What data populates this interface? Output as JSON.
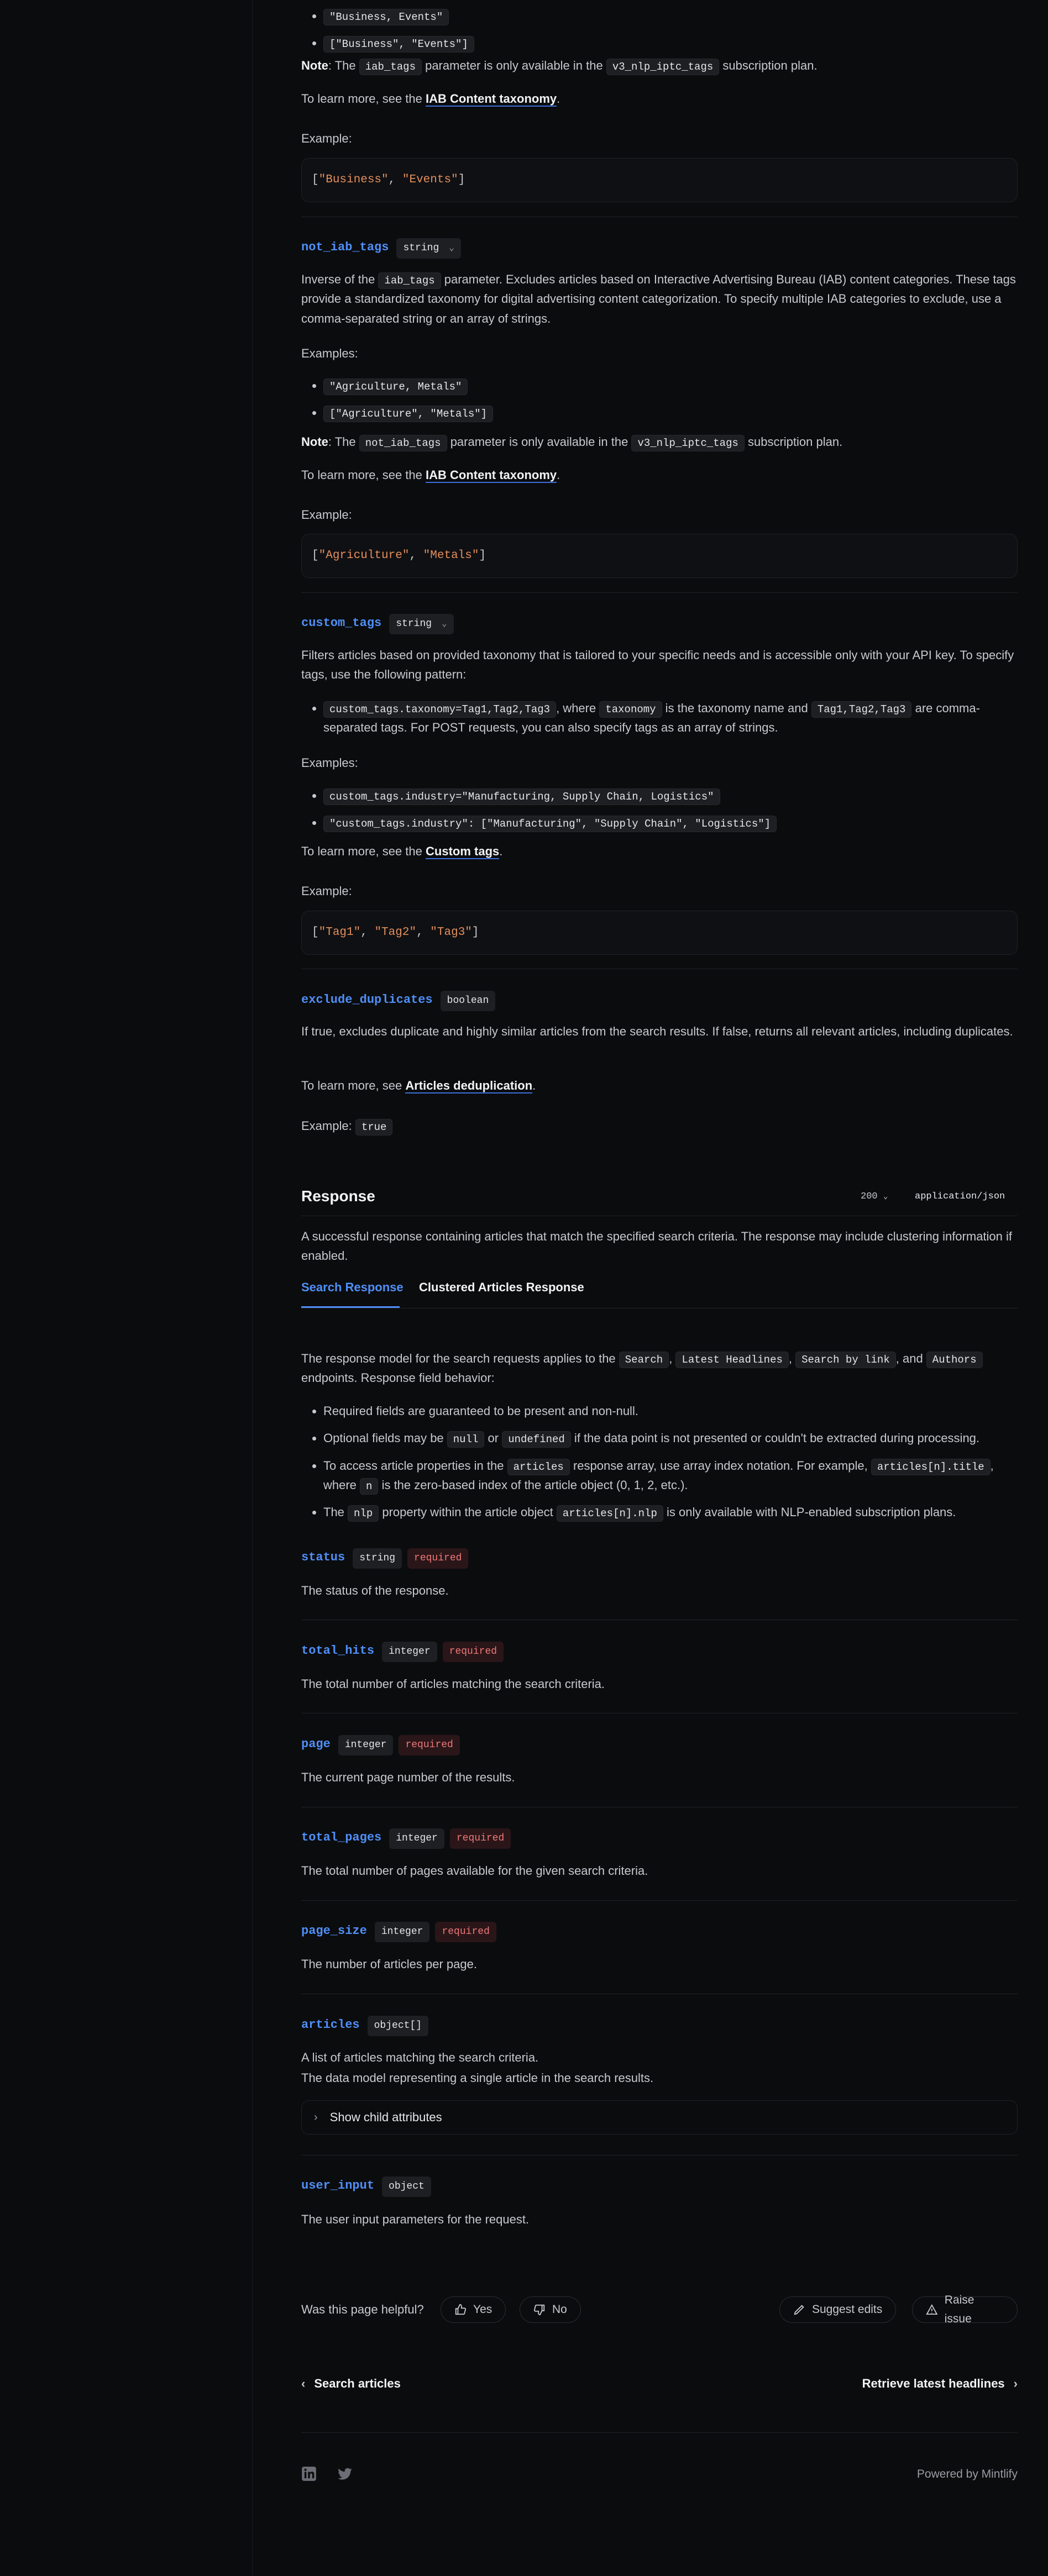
{
  "iab": {
    "ex1": "\"Business, Events\"",
    "ex2": "[\"Business\", \"Events\"]",
    "note_label": "Note",
    "note_a": ": The ",
    "note_code": "iab_tags",
    "note_b": " parameter is only available in the ",
    "note_plan": "v3_nlp_iptc_tags",
    "note_c": " subscription plan.",
    "learn_a": "To learn more, see the ",
    "learn_link": "IAB Content taxonomy",
    "example_label": "Example:",
    "example_code": [
      "\"Business\"",
      "\"Events\""
    ]
  },
  "not_iab": {
    "name": "not_iab_tags",
    "type": "string",
    "desc_a": "Inverse of the ",
    "desc_code": "iab_tags",
    "desc_b": " parameter. Excludes articles based on Interactive Advertising Bureau (IAB) content categories. These tags provide a standardized taxonomy for digital advertising content categorization. To specify multiple IAB categories to exclude, use a comma-separated string or an array of strings.",
    "examples_label": "Examples:",
    "ex1": "\"Agriculture, Metals\"",
    "ex2": "[\"Agriculture\", \"Metals\"]",
    "note_label": "Note",
    "note_a": ": The ",
    "note_code": "not_iab_tags",
    "note_b": " parameter is only available in the ",
    "note_plan": "v3_nlp_iptc_tags",
    "note_c": " subscription plan.",
    "learn_a": "To learn more, see the ",
    "learn_link": "IAB Content taxonomy",
    "example_label": "Example:",
    "example_code": [
      "\"Agriculture\"",
      "\"Metals\""
    ]
  },
  "custom": {
    "name": "custom_tags",
    "type": "string",
    "desc": "Filters articles based on provided taxonomy that is tailored to your specific needs and is accessible only with your API key. To specify tags, use the following pattern:",
    "pattern_code": "custom_tags.taxonomy=Tag1,Tag2,Tag3",
    "pattern_a": ", where ",
    "pattern_code2": "taxonomy",
    "pattern_b": " is the taxonomy name and ",
    "pattern_code3": "Tag1,Tag2,Tag3",
    "pattern_c": " are comma-separated tags. For POST requests, you can also specify tags as an array of strings.",
    "examples_label": "Examples:",
    "ex1": "custom_tags.industry=\"Manufacturing, Supply Chain, Logistics\"",
    "ex2": "\"custom_tags.industry\": [\"Manufacturing\", \"Supply Chain\", \"Logistics\"]",
    "learn_a": "To learn more, see the ",
    "learn_link": "Custom tags",
    "example_label": "Example:",
    "example_code": [
      "\"Tag1\"",
      "\"Tag2\"",
      "\"Tag3\""
    ]
  },
  "dedup": {
    "name": "exclude_duplicates",
    "type": "boolean",
    "desc": "If true, excludes duplicate and highly similar articles from the search results. If false, returns all relevant articles, including duplicates.",
    "learn_a": "To learn more, see ",
    "learn_link": "Articles deduplication",
    "example_label": "Example:",
    "example_value": "true"
  },
  "response": {
    "title": "Response",
    "status_code": "200",
    "content_type": "application/json",
    "desc": "A successful response containing articles that match the specified search criteria. The response may include clustering information if enabled.",
    "tabs": [
      "Search Response",
      "Clustered Articles Response"
    ],
    "model_a": "The response model for the search requests applies to the ",
    "model_codes": [
      "Search",
      "Latest Headlines",
      "Search by link",
      "Authors"
    ],
    "model_b": " endpoints. Response field behavior:",
    "bullets": {
      "b1": "Required fields are guaranteed to be present and non-null.",
      "b2_a": "Optional fields may be ",
      "b2_c1": "null",
      "b2_b": " or ",
      "b2_c2": "undefined",
      "b2_c": " if the data point is not presented or couldn't be extracted during processing.",
      "b3_a": "To access article properties in the ",
      "b3_c1": "articles",
      "b3_b": " response array, use array index notation. For example, ",
      "b3_c2": "articles[n].title",
      "b3_c": ", where ",
      "b3_c3": "n",
      "b3_d": " is the zero-based index of the article object (0, 1, 2, etc.).",
      "b4_a": "The ",
      "b4_c1": "nlp",
      "b4_b": " property within the article object ",
      "b4_c2": "articles[n].nlp",
      "b4_c": " is only available with NLP-enabled subscription plans."
    },
    "required_label": "required",
    "fields": [
      {
        "name": "status",
        "type": "string",
        "required": true,
        "desc": "The status of the response."
      },
      {
        "name": "total_hits",
        "type": "integer",
        "required": true,
        "desc": "The total number of articles matching the search criteria."
      },
      {
        "name": "page",
        "type": "integer",
        "required": true,
        "desc": "The current page number of the results."
      },
      {
        "name": "total_pages",
        "type": "integer",
        "required": true,
        "desc": "The total number of pages available for the given search criteria."
      },
      {
        "name": "page_size",
        "type": "integer",
        "required": true,
        "desc": "The number of articles per page."
      }
    ],
    "articles": {
      "name": "articles",
      "type": "object[]",
      "desc1": "A list of articles matching the search criteria.",
      "desc2": "The data model representing a single article in the search results.",
      "show_child": "Show child attributes"
    },
    "user_input": {
      "name": "user_input",
      "type": "object",
      "desc": "The user input parameters for the request."
    }
  },
  "feedback": {
    "question": "Was this page helpful?",
    "yes": "Yes",
    "no": "No",
    "suggest": "Suggest edits",
    "raise": "Raise issue"
  },
  "pager": {
    "prev": "Search articles",
    "next": "Retrieve latest headlines"
  },
  "footer": {
    "powered": "Powered by Mintlify"
  }
}
